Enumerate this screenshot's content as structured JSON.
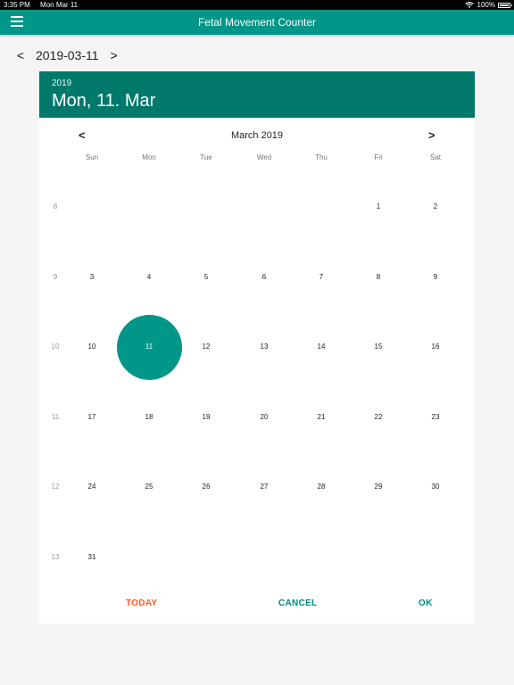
{
  "status_bar": {
    "time": "3:35 PM",
    "date": "Mon Mar 11",
    "battery": "100%"
  },
  "app_bar": {
    "title": "Fetal Movement Counter",
    "menu_icon": "hamburger-menu-icon"
  },
  "date_nav": {
    "prev_label": "<",
    "date": "2019-03-11",
    "next_label": ">"
  },
  "picker": {
    "header_year": "2019",
    "header_date": "Mon, 11. Mar",
    "month_label": "March 2019",
    "prev_month": "<",
    "next_month": ">",
    "weekdays": [
      "Sun",
      "Mon",
      "Tue",
      "Wed",
      "Thu",
      "Fri",
      "Sat"
    ],
    "weeks": [
      {
        "week_no": "8",
        "days": [
          "",
          "",
          "",
          "",
          "",
          "1",
          "2"
        ]
      },
      {
        "week_no": "9",
        "days": [
          "3",
          "4",
          "5",
          "6",
          "7",
          "8",
          "9"
        ]
      },
      {
        "week_no": "10",
        "days": [
          "10",
          "11",
          "12",
          "13",
          "14",
          "15",
          "16"
        ]
      },
      {
        "week_no": "11",
        "days": [
          "17",
          "18",
          "19",
          "20",
          "21",
          "22",
          "23"
        ]
      },
      {
        "week_no": "12",
        "days": [
          "24",
          "25",
          "26",
          "27",
          "28",
          "29",
          "30"
        ]
      },
      {
        "week_no": "13",
        "days": [
          "31",
          "",
          "",
          "",
          "",
          "",
          ""
        ]
      }
    ],
    "selected_day": "11",
    "actions": {
      "today": "TODAY",
      "cancel": "CANCEL",
      "ok": "OK"
    }
  },
  "colors": {
    "primary": "#009688",
    "header": "#00796b",
    "today_button": "#ff5722",
    "action": "#00897b"
  }
}
